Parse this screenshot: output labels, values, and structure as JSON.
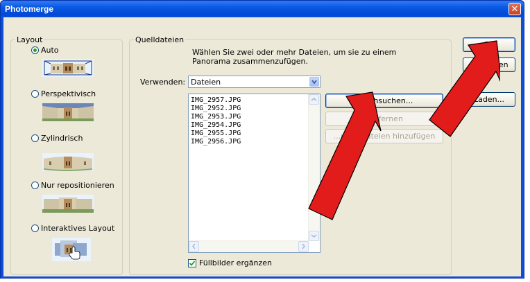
{
  "window": {
    "title": "Photomerge",
    "close_glyph": "✕"
  },
  "layout": {
    "legend": "Layout",
    "options": [
      {
        "label": "Auto",
        "selected": true,
        "thumb": "auto-thumbnail"
      },
      {
        "label": "Perspektivisch",
        "selected": false,
        "thumb": "perspective-thumbnail"
      },
      {
        "label": "Zylindrisch",
        "selected": false,
        "thumb": "cylindrical-thumbnail"
      },
      {
        "label": "Nur repositionieren",
        "selected": false,
        "thumb": "reposition-thumbnail"
      },
      {
        "label": "Interaktives Layout",
        "selected": false,
        "thumb": "interactive-thumbnail"
      }
    ]
  },
  "source": {
    "legend": "Quelldateien",
    "description": "Wählen Sie zwei oder mehr Dateien, um sie zu einem Panorama zusammenzufügen.",
    "use_label": "Verwenden:",
    "use_value": "Dateien",
    "files": [
      "IMG_2957.JPG",
      "IMG_2952.JPG",
      "IMG_2953.JPG",
      "IMG_2954.JPG",
      "IMG_2955.JPG",
      "IMG_2956.JPG"
    ],
    "browse_label": "Durchsuchen...",
    "remove_label": "Entfernen",
    "add_open_label": "...nete Dateien hinzufügen",
    "fill_label": "Füllbilder ergänzen",
    "fill_checked": true
  },
  "buttons": {
    "ok": "OK",
    "cancel": "...brechen",
    "load": "Laden..."
  },
  "colors": {
    "annotation_arrow": "#e21b1b",
    "titlebar": "#0a58e3",
    "dialog_bg": "#ece9d8"
  },
  "icons": {
    "close": "close-icon",
    "dropdown": "chevron-down-icon",
    "checkbox": "checkmark-icon",
    "pointer": "hand-cursor-icon"
  }
}
